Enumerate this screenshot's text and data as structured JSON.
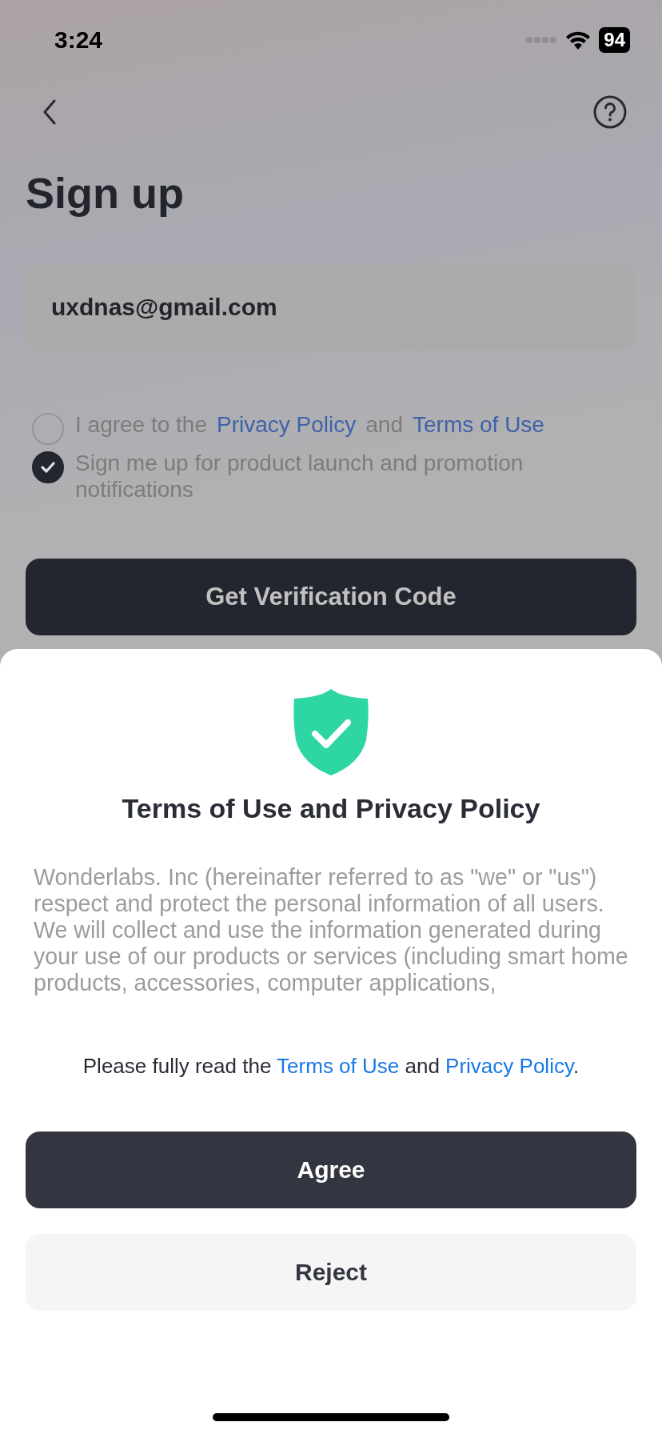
{
  "status_bar": {
    "time": "3:24",
    "battery": "94"
  },
  "title": "Sign up",
  "email_field": {
    "value": "uxdnas@gmail.com"
  },
  "checkboxes": [
    {
      "checked": false,
      "segments": [
        {
          "kind": "text",
          "text": "I agree to the"
        },
        {
          "kind": "link",
          "text": "Privacy Policy"
        },
        {
          "kind": "text",
          "text": "and"
        },
        {
          "kind": "link",
          "text": "Terms of Use"
        }
      ]
    },
    {
      "checked": true,
      "segments": [
        {
          "kind": "text",
          "text": "Sign me up for product launch and promotion notifications"
        }
      ]
    }
  ],
  "primary_button": "Get Verification Code",
  "sheet": {
    "title": "Terms of Use and Privacy Policy",
    "body": "Wonderlabs. Inc (hereinafter referred to as \"we\" or \"us\") respect and protect the personal information of all users. We will collect and use the information generated during your use of our products or services (including smart home products, accessories, computer applications,",
    "notice": [
      {
        "kind": "text",
        "text": "Please fully read the "
      },
      {
        "kind": "link",
        "text": "Terms of Use"
      },
      {
        "kind": "text",
        "text": " and "
      },
      {
        "kind": "link",
        "text": "Privacy Policy"
      },
      {
        "kind": "text",
        "text": "."
      }
    ],
    "buttons": [
      {
        "kind": "primary",
        "label": "Agree"
      },
      {
        "kind": "secondary",
        "label": "Reject"
      }
    ]
  }
}
